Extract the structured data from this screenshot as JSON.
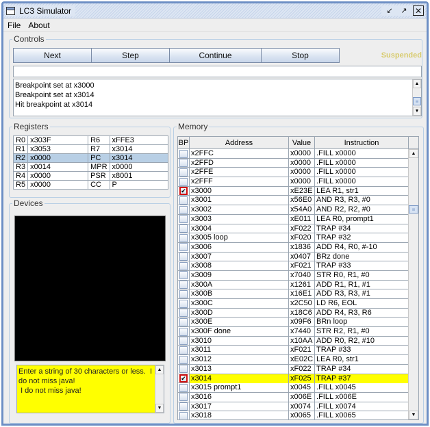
{
  "window": {
    "title": "LC3 Simulator",
    "icons": [
      "minimize-icon",
      "maximize-icon",
      "close-icon"
    ]
  },
  "menu": [
    "File",
    "About"
  ],
  "controls": {
    "label": "Controls",
    "buttons": [
      "Next",
      "Step",
      "Continue",
      "Stop"
    ],
    "status": "Suspended",
    "command_input": "",
    "console": [
      "Breakpoint set at x3000",
      "Breakpoint set at x3014",
      "Hit breakpoint at x3014"
    ]
  },
  "registers": {
    "label": "Registers",
    "rows": [
      {
        "n1": "R0",
        "v1": "x303F",
        "n2": "R6",
        "v2": "xFFE3"
      },
      {
        "n1": "R1",
        "v1": "x3053",
        "n2": "R7",
        "v2": "x3014"
      },
      {
        "n1": "R2",
        "v1": "x0000",
        "n2": "PC",
        "v2": "x3014"
      },
      {
        "n1": "R3",
        "v1": "x0014",
        "n2": "MPR",
        "v2": "x0000"
      },
      {
        "n1": "R4",
        "v1": "x0000",
        "n2": "PSR",
        "v2": "x8001"
      },
      {
        "n1": "R5",
        "v1": "x0000",
        "n2": "CC",
        "v2": "P"
      }
    ],
    "selected_row": 2
  },
  "devices": {
    "label": "Devices",
    "output_text": "Enter a string of 30 characters or less.  I do not miss java!\n I do not miss java!"
  },
  "memory": {
    "label": "Memory",
    "columns": [
      "BP",
      "Address",
      "Value",
      "Instruction"
    ],
    "highlight_color": "#ffff00",
    "rows": [
      {
        "bp": false,
        "addr": "x2FFC",
        "val": "x0000",
        "ins": ".FILL x0000"
      },
      {
        "bp": false,
        "addr": "x2FFD",
        "val": "x0000",
        "ins": ".FILL x0000"
      },
      {
        "bp": false,
        "addr": "x2FFE",
        "val": "x0000",
        "ins": ".FILL x0000"
      },
      {
        "bp": false,
        "addr": "x2FFF",
        "val": "x0000",
        "ins": ".FILL x0000"
      },
      {
        "bp": true,
        "addr": "x3000",
        "val": "xE23E",
        "ins": "LEA R1, str1"
      },
      {
        "bp": false,
        "addr": "x3001",
        "val": "x56E0",
        "ins": "AND R3, R3, #0"
      },
      {
        "bp": false,
        "addr": "x3002",
        "val": "x54A0",
        "ins": "AND R2, R2, #0"
      },
      {
        "bp": false,
        "addr": "x3003",
        "val": "xE011",
        "ins": "LEA R0, prompt1"
      },
      {
        "bp": false,
        "addr": "x3004",
        "val": "xF022",
        "ins": "TRAP #34"
      },
      {
        "bp": false,
        "addr": "x3005 loop",
        "val": "xF020",
        "ins": "TRAP #32"
      },
      {
        "bp": false,
        "addr": "x3006",
        "val": "x1836",
        "ins": "ADD R4, R0, #-10"
      },
      {
        "bp": false,
        "addr": "x3007",
        "val": "x0407",
        "ins": "BRz done"
      },
      {
        "bp": false,
        "addr": "x3008",
        "val": "xF021",
        "ins": "TRAP #33"
      },
      {
        "bp": false,
        "addr": "x3009",
        "val": "x7040",
        "ins": "STR R0, R1, #0"
      },
      {
        "bp": false,
        "addr": "x300A",
        "val": "x1261",
        "ins": "ADD R1, R1, #1"
      },
      {
        "bp": false,
        "addr": "x300B",
        "val": "x16E1",
        "ins": "ADD R3, R3, #1"
      },
      {
        "bp": false,
        "addr": "x300C",
        "val": "x2C50",
        "ins": "LD R6, EOL"
      },
      {
        "bp": false,
        "addr": "x300D",
        "val": "x18C6",
        "ins": "ADD R4, R3, R6"
      },
      {
        "bp": false,
        "addr": "x300E",
        "val": "x09F6",
        "ins": "BRn loop"
      },
      {
        "bp": false,
        "addr": "x300F done",
        "val": "x7440",
        "ins": "STR R2, R1, #0"
      },
      {
        "bp": false,
        "addr": "x3010",
        "val": "x10AA",
        "ins": "ADD R0, R2, #10"
      },
      {
        "bp": false,
        "addr": "x3011",
        "val": "xF021",
        "ins": "TRAP #33"
      },
      {
        "bp": false,
        "addr": "x3012",
        "val": "xE02C",
        "ins": "LEA R0, str1"
      },
      {
        "bp": false,
        "addr": "x3013",
        "val": "xF022",
        "ins": "TRAP #34"
      },
      {
        "bp": true,
        "addr": "x3014",
        "val": "xF025",
        "ins": "TRAP #37",
        "highlight": true
      },
      {
        "bp": false,
        "addr": "x3015 prompt1",
        "val": "x0045",
        "ins": ".FILL x0045"
      },
      {
        "bp": false,
        "addr": "x3016",
        "val": "x006E",
        "ins": ".FILL x006E"
      },
      {
        "bp": false,
        "addr": "x3017",
        "val": "x0074",
        "ins": ".FILL x0074"
      },
      {
        "bp": false,
        "addr": "x3018",
        "val": "x0065",
        "ins": ".FILL x0065"
      }
    ]
  }
}
